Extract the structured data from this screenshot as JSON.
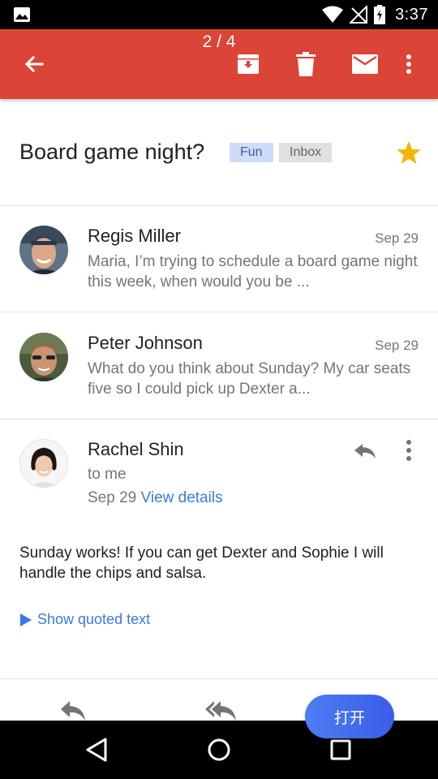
{
  "status_bar": {
    "time": "3:37"
  },
  "app_bar": {
    "counter": "2 / 4"
  },
  "subject": {
    "title": "Board game night?",
    "labels": [
      "Fun",
      "Inbox"
    ]
  },
  "messages": [
    {
      "sender": "Regis Miller",
      "date": "Sep 29",
      "snippet": "Maria, I’m trying to schedule a board game night this week, when would you be ..."
    },
    {
      "sender": "Peter Johnson",
      "date": "Sep 29",
      "snippet": "What do you think about Sunday? My car seats five so I could pick up Dexter a..."
    }
  ],
  "expanded": {
    "sender": "Rachel Shin",
    "recipient": "to me",
    "date": "Sep 29",
    "view_details": "View details",
    "body": "Sunday works! If you can get Dexter and Sophie I will handle the chips and salsa.",
    "show_quoted": "Show quoted text"
  },
  "open_button": "打开",
  "colors": {
    "app_bar": "#db4437",
    "link": "#3b78e7",
    "star": "#f4b400",
    "fun_label_bg": "#cfdcf7",
    "inbox_label_bg": "#e0e0e0"
  },
  "icons": [
    "image-icon",
    "wifi-icon",
    "no-signal-icon",
    "battery-icon",
    "back-arrow-icon",
    "archive-icon",
    "delete-icon",
    "mail-icon",
    "more-vert-icon",
    "star-icon",
    "reply-icon",
    "reply-all-icon",
    "play-triangle-icon",
    "nav-back-icon",
    "nav-home-icon",
    "nav-recents-icon"
  ]
}
